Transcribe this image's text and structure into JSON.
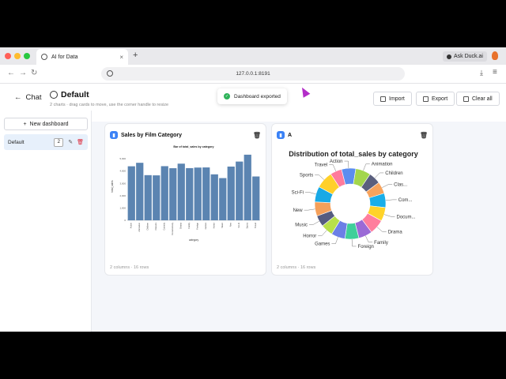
{
  "browser": {
    "tab_title": "AI for Data",
    "tab_close": "×",
    "new_tab": "+",
    "url": "127.0.0.1:8191",
    "ask_duck": "Ask Duck.ai",
    "back_icon": "←",
    "forward_icon": "→",
    "reload_icon": "↻",
    "download_icon": "⤓",
    "menu_icon": "≡"
  },
  "header": {
    "back_label": "Chat",
    "back_arrow": "←",
    "title": "Default",
    "subtitle": "2 charts · drag cards to move, use the corner handle to resize",
    "toast": "Dashboard exported",
    "toast_icon": "✓",
    "import_label": "Import",
    "export_label": "Export",
    "clear_label": "Clear all"
  },
  "sidebar": {
    "new_button": "New dashboard",
    "new_icon": "+",
    "items": [
      {
        "label": "Default",
        "count": "2",
        "edit_icon": "✎",
        "delete_icon": "🗑"
      }
    ]
  },
  "cards": [
    {
      "title": "Sales by Film Category",
      "footer": "2 columns · 16 rows",
      "delete_icon": "🗑"
    },
    {
      "title": "A",
      "footer": "2 columns · 16 rows",
      "delete_icon": "🗑"
    }
  ],
  "chart_data": [
    {
      "type": "bar",
      "title": "Bar of total_sales by category",
      "xlabel": "category",
      "ylabel": "total_sales",
      "categories": [
        "Action",
        "Animation",
        "Children",
        "Classics",
        "Comedy",
        "Documentary",
        "Drama",
        "Family",
        "Foreign",
        "Games",
        "Horror",
        "Music",
        "New",
        "Sci-Fi",
        "Sports",
        "Travel"
      ],
      "values": [
        4375,
        4657,
        3656,
        3639,
        4384,
        4218,
        4587,
        4226,
        4271,
        4281,
        3722,
        3418,
        4352,
        4757,
        5314,
        3549
      ],
      "yticks": [
        "0",
        "1,000",
        "2,000",
        "3,000",
        "4,000",
        "5,000"
      ],
      "ylim": [
        0,
        5500
      ],
      "color": "#5b84b1"
    },
    {
      "type": "pie",
      "title": "Distribution of total_sales by category",
      "labels": [
        "Action",
        "Animation",
        "Children",
        "Clas...",
        "Com...",
        "Docum...",
        "Drama",
        "Family",
        "Foreign",
        "Games",
        "Horror",
        "Music",
        "New",
        "Sci-Fi",
        "Sports",
        "Travel"
      ],
      "values": [
        4375,
        4657,
        3656,
        3639,
        4384,
        4218,
        4587,
        4226,
        4271,
        4281,
        3722,
        3418,
        4352,
        4757,
        5314,
        3549
      ],
      "colors": [
        "#5b8def",
        "#a3d64c",
        "#5a5f7d",
        "#f7a35c",
        "#1aaee8",
        "#ffd329",
        "#ff7e9d",
        "#9a6ad6",
        "#3fcf9a",
        "#6c7fe6",
        "#b8e04a",
        "#555c80",
        "#f5a05a",
        "#19a9e6",
        "#ffd02a",
        "#ff7b9c"
      ],
      "hole": true,
      "legend": "none"
    }
  ]
}
